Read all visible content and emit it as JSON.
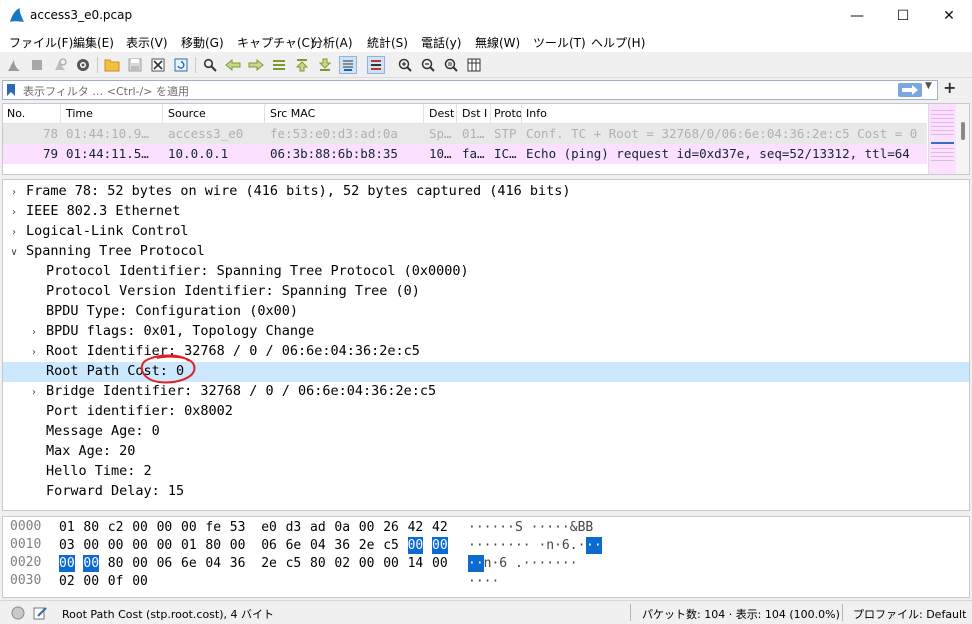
{
  "window": {
    "title": "access3_e0.pcap",
    "minimize": "—",
    "maximize": "☐",
    "close": "✕"
  },
  "menu": [
    "ファイル(F)",
    "編集(E)",
    "表示(V)",
    "移動(G)",
    "キャプチャ(C)",
    "分析(A)",
    "統計(S)",
    "電話(y)",
    "無線(W)",
    "ツール(T)",
    "ヘルプ(H)"
  ],
  "filter": {
    "placeholder": "表示フィルタ … <Ctrl-/> を適用"
  },
  "packet_list": {
    "columns": [
      "No.",
      "Time",
      "Source",
      "Src MAC",
      "Dest",
      "Dst I",
      "Proto",
      "Info"
    ],
    "rows": [
      {
        "no": "78",
        "time": "01:44:10.9…",
        "source": "access3_e0",
        "src_mac": "fe:53:e0:d3:ad:0a",
        "dest": "Sp…",
        "dst_i": "01…",
        "proto": "STP",
        "info": "Conf. TC + Root = 32768/0/06:6e:04:36:2e:c5  Cost = 0"
      },
      {
        "no": "79",
        "time": "01:44:11.5…",
        "source": "10.0.0.1",
        "src_mac": "06:3b:88:6b:b8:35",
        "dest": "10…",
        "dst_i": "fa…",
        "proto": "IC…",
        "info": "Echo (ping) request  id=0xd37e, seq=52/13312, ttl=64"
      }
    ]
  },
  "details": [
    {
      "text": "Frame 78: 52 bytes on wire (416 bits), 52 bytes captured (416 bits)",
      "level": 0,
      "expander": "collapsed"
    },
    {
      "text": "IEEE 802.3 Ethernet",
      "level": 0,
      "expander": "collapsed"
    },
    {
      "text": "Logical-Link Control",
      "level": 0,
      "expander": "collapsed"
    },
    {
      "text": "Spanning Tree Protocol",
      "level": 0,
      "expander": "expanded"
    },
    {
      "text": "Protocol Identifier: Spanning Tree Protocol (0x0000)",
      "level": 1,
      "expander": "none"
    },
    {
      "text": "Protocol Version Identifier: Spanning Tree (0)",
      "level": 1,
      "expander": "none"
    },
    {
      "text": "BPDU Type: Configuration (0x00)",
      "level": 1,
      "expander": "none"
    },
    {
      "text": "BPDU flags: 0x01, Topology Change",
      "level": 1,
      "expander": "collapsed"
    },
    {
      "text": "Root Identifier: 32768 / 0 / 06:6e:04:36:2e:c5",
      "level": 1,
      "expander": "collapsed"
    },
    {
      "text": "Root Path Cost: 0",
      "level": 1,
      "expander": "none",
      "selected": true
    },
    {
      "text": "Bridge Identifier: 32768 / 0 / 06:6e:04:36:2e:c5",
      "level": 1,
      "expander": "collapsed"
    },
    {
      "text": "Port identifier: 0x8002",
      "level": 1,
      "expander": "none"
    },
    {
      "text": "Message Age: 0",
      "level": 1,
      "expander": "none"
    },
    {
      "text": "Max Age: 20",
      "level": 1,
      "expander": "none"
    },
    {
      "text": "Hello Time: 2",
      "level": 1,
      "expander": "none"
    },
    {
      "text": "Forward Delay: 15",
      "level": 1,
      "expander": "none"
    }
  ],
  "hex": [
    {
      "offset": "0000",
      "bytes": [
        "01",
        "80",
        "c2",
        "00",
        "00",
        "00",
        "fe",
        "53",
        "e0",
        "d3",
        "ad",
        "0a",
        "00",
        "26",
        "42",
        "42"
      ],
      "ascii": "······S ·····&BB"
    },
    {
      "offset": "0010",
      "bytes": [
        "03",
        "00",
        "00",
        "00",
        "00",
        "01",
        "80",
        "00",
        "06",
        "6e",
        "04",
        "36",
        "2e",
        "c5",
        "00",
        "00"
      ],
      "ascii": "········ ·n·6.··"
    },
    {
      "offset": "0020",
      "bytes": [
        "00",
        "00",
        "80",
        "00",
        "06",
        "6e",
        "04",
        "36",
        "2e",
        "c5",
        "80",
        "02",
        "00",
        "00",
        "14",
        "00"
      ],
      "ascii": "··n·6 .·······"
    },
    {
      "offset": "0030",
      "bytes": [
        "02",
        "00",
        "0f",
        "00"
      ],
      "ascii": "····"
    }
  ],
  "hex_highlight": {
    "row1_bytes": [
      14,
      15
    ],
    "row2_bytes": [
      0,
      1
    ]
  },
  "status": {
    "field": "Root Path Cost (stp.root.cost), 4 バイト",
    "packets": "パケット数: 104 · 表示: 104 (100.0%)",
    "profile": "プロファイル: Default"
  },
  "colors": {
    "stp_row": "#e8e8e8",
    "icmp_row": "#fce0ff",
    "selection": "#cce8ff",
    "hex_highlight": "#0c6ad0",
    "annotation": "#e02020"
  }
}
